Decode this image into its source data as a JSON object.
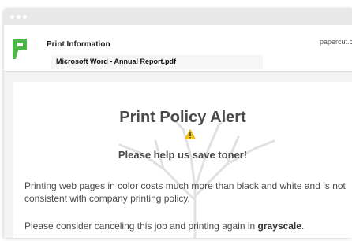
{
  "header": {
    "title": "Print Information",
    "document_name": "Microsoft Word - Annual Report.pdf",
    "domain": "papercut.co"
  },
  "alert": {
    "title": "Print Policy Alert",
    "subtitle": "Please help us save toner!",
    "paragraph1": "Printing web pages in color costs much more than black and white and is not consistent with company printing policy.",
    "paragraph2_prefix": "Please consider canceling this job and printing again in",
    "paragraph2_emphasis": "grayscale",
    "paragraph2_suffix": "."
  },
  "icons": {
    "logo": "papercut-logo",
    "warning": "warning-icon",
    "background": "tree-watermark"
  },
  "colors": {
    "logo_green": "#4cb848",
    "warning_yellow": "#f5c518",
    "text": "#4a4a4a"
  }
}
